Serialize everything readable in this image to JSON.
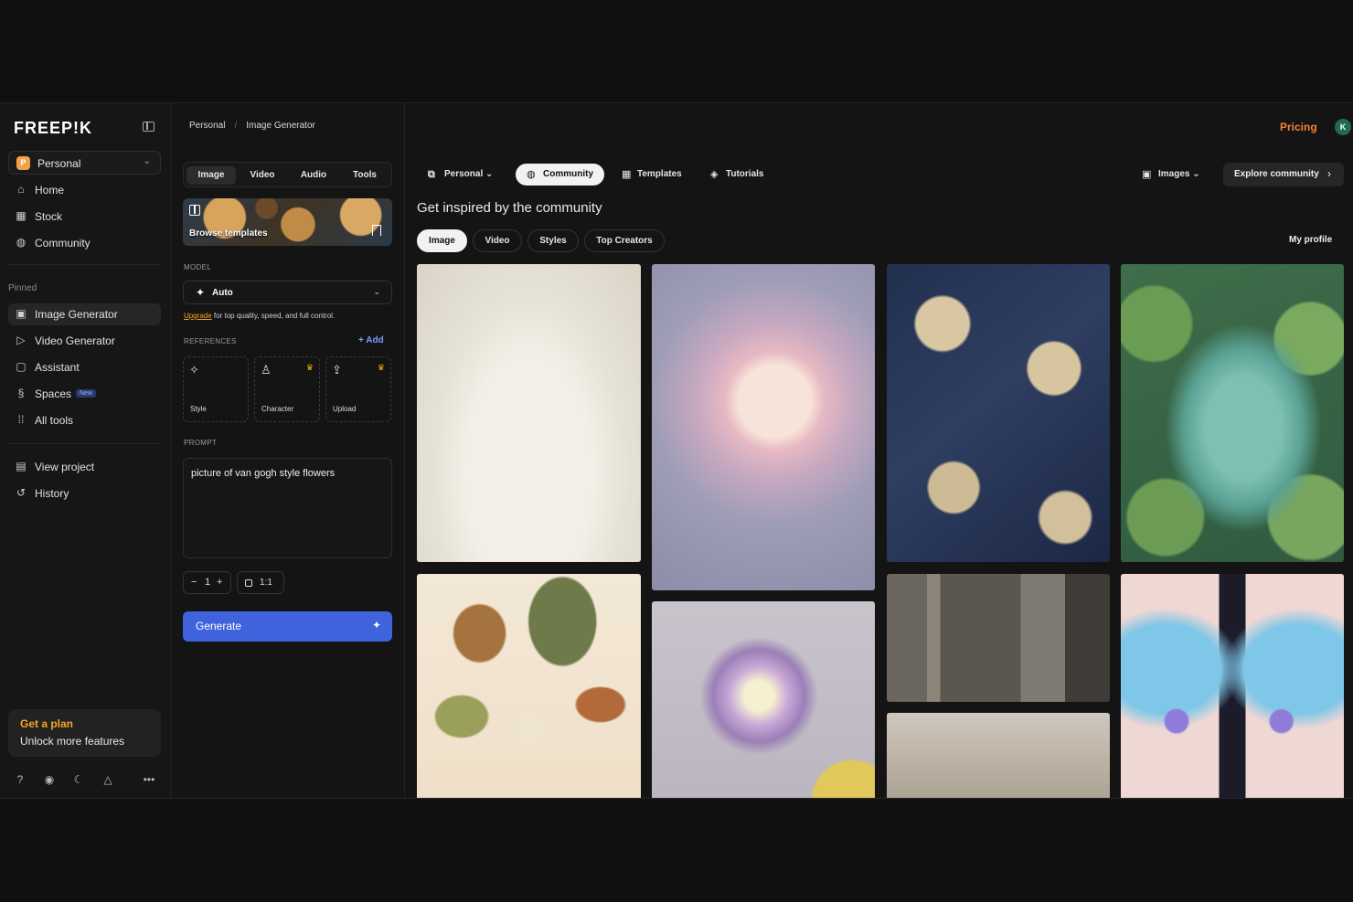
{
  "brand": "FREEP!K",
  "workspace": {
    "badge": "P",
    "label": "Personal"
  },
  "nav": {
    "main": [
      {
        "label": "Home",
        "icon": "home-icon"
      },
      {
        "label": "Stock",
        "icon": "grid-icon"
      },
      {
        "label": "Community",
        "icon": "globe-icon"
      }
    ],
    "pinned_label": "Pinned",
    "pinned": [
      {
        "label": "Image Generator",
        "icon": "image-icon",
        "active": true
      },
      {
        "label": "Video Generator",
        "icon": "video-icon"
      },
      {
        "label": "Assistant",
        "icon": "chat-icon"
      },
      {
        "label": "Spaces",
        "icon": "spaces-icon",
        "tag": "New"
      },
      {
        "label": "All tools",
        "icon": "apps-icon"
      }
    ],
    "bottom": [
      {
        "label": "View project",
        "icon": "project-icon"
      },
      {
        "label": "History",
        "icon": "history-icon"
      }
    ]
  },
  "plan": {
    "title": "Get a plan",
    "subtitle": "Unlock more features"
  },
  "footer_icons": [
    "help-icon",
    "discord-icon",
    "moon-icon",
    "bell-icon",
    "more-icon"
  ],
  "breadcrumb": {
    "root": "Personal",
    "separator": "/",
    "current": "Image Generator"
  },
  "generator": {
    "tabs": [
      "Image",
      "Video",
      "Audio",
      "Tools"
    ],
    "active_tab": "Image",
    "banner_label": "Browse templates",
    "model_section": "MODEL",
    "model_value": "Auto",
    "upgrade_link": "Upgrade",
    "upgrade_text": " for top quality, speed, and full control.",
    "references_section": "REFERENCES",
    "add_label": "Add",
    "references": [
      {
        "label": "Style",
        "icon": "style-icon",
        "premium": false
      },
      {
        "label": "Character",
        "icon": "character-icon",
        "premium": true
      },
      {
        "label": "Upload",
        "icon": "upload-icon",
        "premium": true
      }
    ],
    "prompt_section": "PROMPT",
    "prompt_value": "picture of van gogh style flowers",
    "count": "1",
    "ratio": "1:1",
    "generate_label": "Generate"
  },
  "header": {
    "pricing": "Pricing",
    "avatar": "K"
  },
  "community": {
    "tabs": [
      "Personal",
      "Community",
      "Templates",
      "Tutorials"
    ],
    "active_tab": "Community",
    "media_select": "Images",
    "explore": "Explore community",
    "headline": "Get inspired by the community",
    "filters": [
      "Image",
      "Video",
      "Styles",
      "Top Creators"
    ],
    "active_filter": "Image",
    "my_profile": "My profile"
  },
  "colors": {
    "accent": "#3e63dd",
    "pricing": "#f0823c",
    "plan": "#f5a623"
  }
}
